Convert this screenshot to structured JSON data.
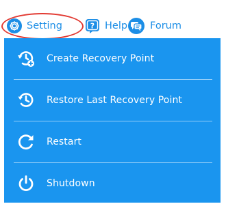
{
  "colors": {
    "accent_blue": "#1c8ee6",
    "menu_bg": "#1a95ef",
    "highlight_red": "#e23a32",
    "menu_text": "#ffffff"
  },
  "topbar": {
    "items": [
      {
        "label": "Setting",
        "icon": "gear-icon"
      },
      {
        "label": "Help",
        "icon": "question-icon"
      },
      {
        "label": "Forum",
        "icon": "chat-bubbles-icon"
      }
    ]
  },
  "menu": {
    "items": [
      {
        "label": "Create Recovery Point",
        "icon": "create-recovery-icon"
      },
      {
        "label": "Restore Last Recovery Point",
        "icon": "restore-icon"
      },
      {
        "label": "Restart",
        "icon": "restart-icon"
      },
      {
        "label": "Shutdown",
        "icon": "power-icon"
      }
    ]
  }
}
